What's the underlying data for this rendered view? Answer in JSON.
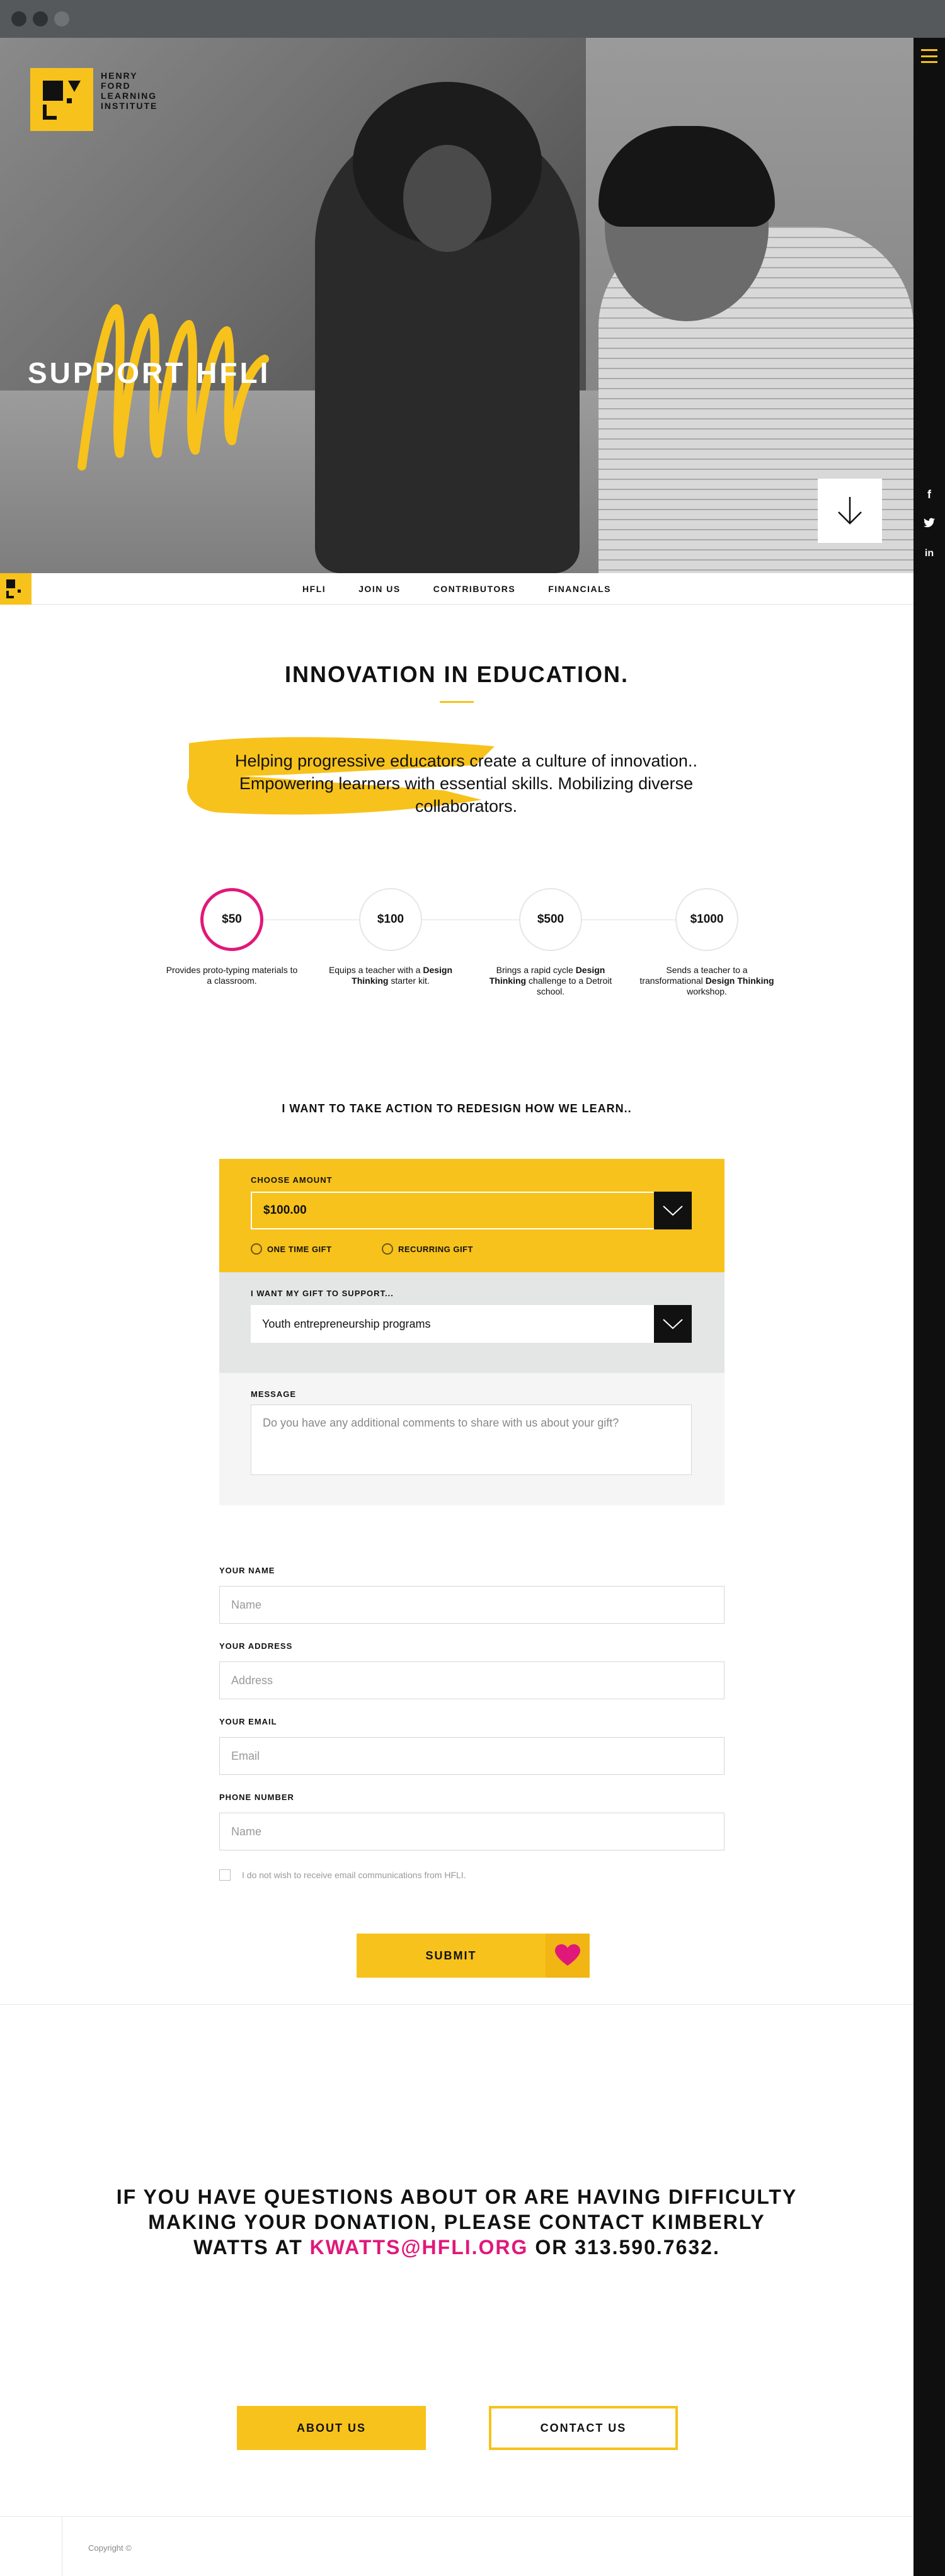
{
  "brand": {
    "logo_lines": [
      "HENRY",
      "FORD",
      "LEARNING",
      "INSTITUTE"
    ],
    "accent": "#f7c21b",
    "pink": "#e0187a"
  },
  "hero": {
    "title": "SUPPORT HFLI"
  },
  "social": [
    "f",
    "y",
    "in"
  ],
  "subnav": {
    "items": [
      "HFLI",
      "JOIN US",
      "CONTRIBUTORS",
      "FINANCIALS"
    ]
  },
  "intro": {
    "title": "INNOVATION IN EDUCATION.",
    "text": "Helping progressive educators create a culture of innovation.. Empowering learners with essential skills. Mobilizing diverse collaborators."
  },
  "steps": [
    {
      "amount": "$50",
      "pre": "Provides proto-typing materials to a classroom.",
      "bold": "",
      "post": ""
    },
    {
      "amount": "$100",
      "pre": "Equips a teacher with a ",
      "bold": "Design Thinking",
      "post": " starter kit."
    },
    {
      "amount": "$500",
      "pre": "Brings a rapid cycle ",
      "bold": "Design Thinking",
      "post": " challenge to a Detroit school."
    },
    {
      "amount": "$1000",
      "pre": "Sends a teacher to a transformational ",
      "bold": "Design Thinking",
      "post": " workshop."
    }
  ],
  "form": {
    "heading": "I WANT TO TAKE ACTION TO REDESIGN HOW WE LEARN..",
    "amount_label": "CHOOSE AMOUNT",
    "amount_value": "$100.00",
    "one_time": "ONE TIME GIFT",
    "recurring": "RECURRING GIFT",
    "support_label": "I WANT MY GIFT TO SUPPORT...",
    "support_value": "Youth entrepreneurship programs",
    "message_label": "MESSAGE",
    "message_placeholder": "Do you have any additional comments to share with us about your gift?",
    "name_label": "YOUR NAME",
    "name_placeholder": "Name",
    "address_label": "YOUR ADDRESS",
    "address_placeholder": "Address",
    "email_label": "YOUR EMAIL",
    "email_placeholder": "Email",
    "phone_label": "PHONE NUMBER",
    "phone_placeholder": "Name",
    "optout": "I do not wish to receive email communications from HFLI.",
    "submit": "SUBMIT"
  },
  "questions": {
    "pre": "IF YOU HAVE QUESTIONS ABOUT OR ARE HAVING DIFFICULTY MAKING YOUR DONATION, PLEASE CONTACT KIMBERLY WATTS AT ",
    "email": "KWATTS@HFLI.ORG",
    "post": " OR 313.590.7632."
  },
  "buttons": {
    "about": "ABOUT US",
    "contact": "CONTACT US"
  },
  "footer": {
    "copyright": "Copyright ©"
  }
}
